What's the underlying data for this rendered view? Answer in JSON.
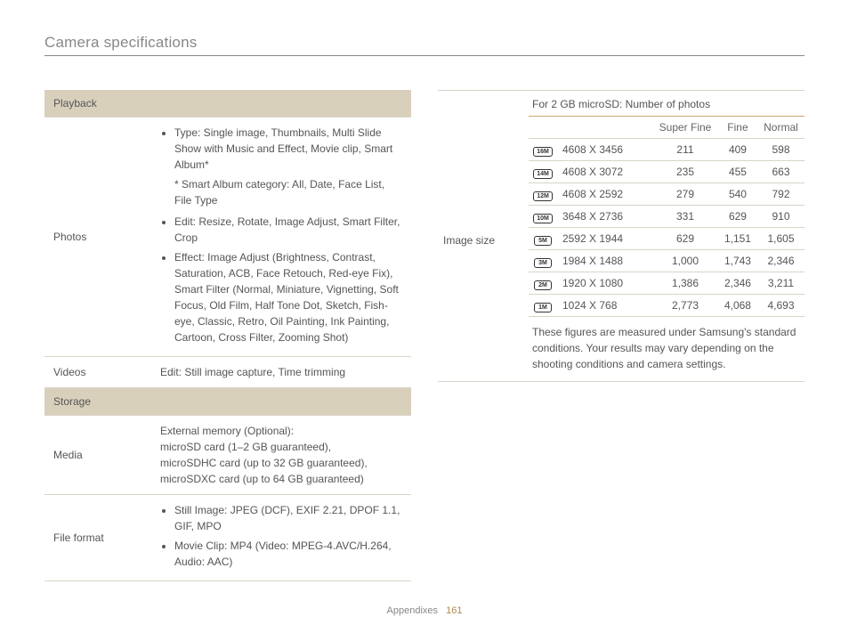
{
  "page": {
    "title": "Camera specifications",
    "footer_section": "Appendixes",
    "page_number": "161"
  },
  "left": {
    "section_playback": "Playback",
    "photos_label": "Photos",
    "photos_b1": "Type: Single image, Thumbnails, Multi Slide Show with Music and Effect, Movie clip, Smart Album*",
    "photos_note": "* Smart Album category: All, Date, Face List, File Type",
    "photos_b2": "Edit: Resize, Rotate, Image Adjust, Smart Filter, Crop",
    "photos_b3": "Effect: Image Adjust (Brightness, Contrast, Saturation, ACB, Face Retouch, Red-eye Fix), Smart Filter (Normal, Miniature, Vignetting, Soft Focus, Old Film, Half Tone Dot, Sketch, Fish-eye, Classic, Retro, Oil Painting, Ink Painting, Cartoon, Cross Filter, Zooming Shot)",
    "videos_label": "Videos",
    "videos_val": "Edit: Still image capture, Time trimming",
    "section_storage": "Storage",
    "media_label": "Media",
    "media_l1": "External memory (Optional):",
    "media_l2": "microSD card (1–2 GB guaranteed),",
    "media_l3": "microSDHC card (up to 32 GB guaranteed),",
    "media_l4": "microSDXC card (up to 64 GB guaranteed)",
    "fileformat_label": "File format",
    "fileformat_b1": "Still Image: JPEG (DCF), EXIF 2.21, DPOF 1.1, GIF, MPO",
    "fileformat_b2": "Movie Clip: MP4 (Video: MPEG-4.AVC/H.264, Audio: AAC)"
  },
  "right": {
    "label": "Image size",
    "caption": "For 2 GB microSD: Number of photos",
    "headers": {
      "empty": "",
      "sf": "Super Fine",
      "fine": "Fine",
      "normal": "Normal"
    },
    "rows": [
      {
        "icon": "16M",
        "res": "4608 X 3456",
        "sf": "211",
        "fine": "409",
        "normal": "598"
      },
      {
        "icon": "14M",
        "res": "4608 X 3072",
        "sf": "235",
        "fine": "455",
        "normal": "663"
      },
      {
        "icon": "12M",
        "res": "4608 X 2592",
        "sf": "279",
        "fine": "540",
        "normal": "792"
      },
      {
        "icon": "10M",
        "res": "3648 X 2736",
        "sf": "331",
        "fine": "629",
        "normal": "910"
      },
      {
        "icon": "5M",
        "res": "2592 X 1944",
        "sf": "629",
        "fine": "1,151",
        "normal": "1,605"
      },
      {
        "icon": "3M",
        "res": "1984 X 1488",
        "sf": "1,000",
        "fine": "1,743",
        "normal": "2,346"
      },
      {
        "icon": "2M",
        "res": "1920 X 1080",
        "sf": "1,386",
        "fine": "2,346",
        "normal": "3,211"
      },
      {
        "icon": "1M",
        "res": "1024 X 768",
        "sf": "2,773",
        "fine": "4,068",
        "normal": "4,693"
      }
    ],
    "footnote": "These figures are measured under Samsung's standard conditions. Your results may vary depending on the shooting conditions and camera settings."
  }
}
